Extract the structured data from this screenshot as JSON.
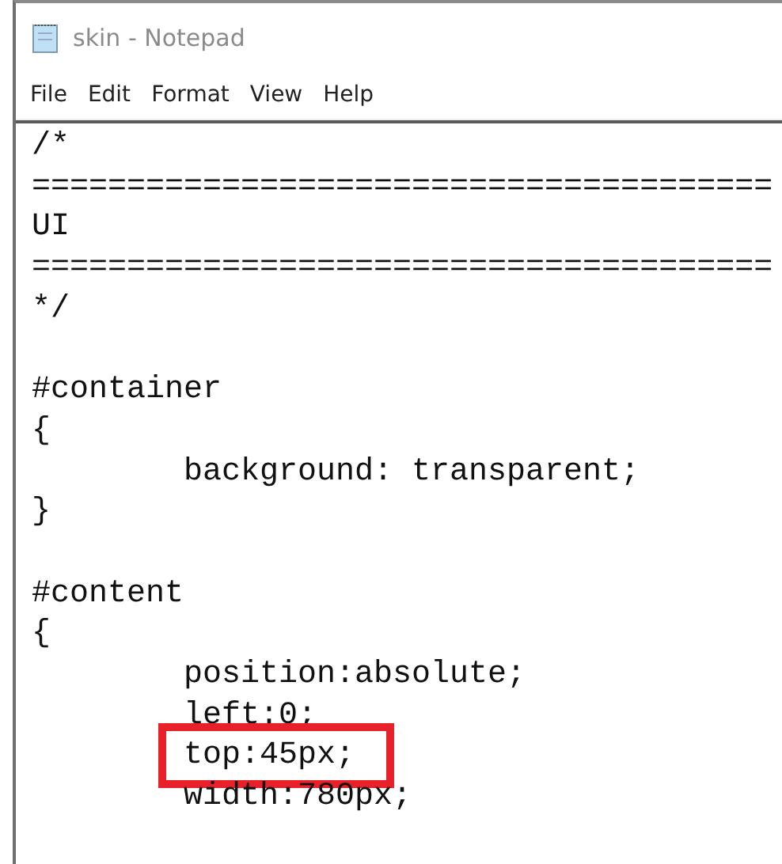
{
  "window": {
    "title": "skin - Notepad"
  },
  "menu": [
    "File",
    "Edit",
    "Format",
    "View",
    "Help"
  ],
  "editor": {
    "lines": [
      {
        "text": "/*",
        "highlighted": false
      },
      {
        "text": "=======================================",
        "highlighted": false
      },
      {
        "text": "UI",
        "highlighted": false
      },
      {
        "text": "=======================================",
        "highlighted": false
      },
      {
        "text": "*/",
        "highlighted": false
      },
      {
        "highlighted": false
      },
      {
        "text": "#container",
        "highlighted": false
      },
      {
        "text": "{",
        "highlighted": false
      },
      {
        "text": "\tbackground: transparent;",
        "highlighted": false
      },
      {
        "text": "}",
        "highlighted": false
      },
      {
        "highlighted": false
      },
      {
        "text": "#content",
        "highlighted": false
      },
      {
        "text": "{",
        "highlighted": false
      },
      {
        "text": "\tposition:absolute;",
        "highlighted": false
      },
      {
        "text": "\tleft:0;",
        "highlighted": false
      },
      {
        "text": "\ttop:45px;",
        "highlighted": true
      },
      {
        "text": "\twidth:780px;",
        "highlighted": false
      }
    ]
  }
}
